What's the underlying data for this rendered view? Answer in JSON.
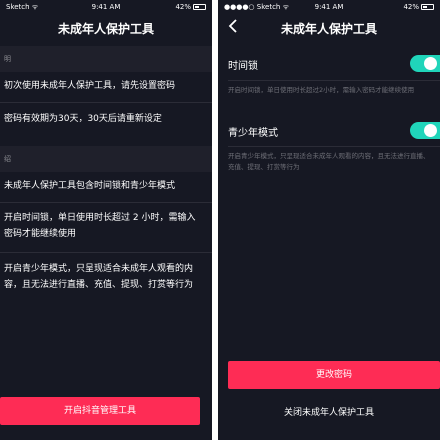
{
  "left": {
    "status": {
      "signal": "Sketch ᯤ",
      "time": "9:41 AM",
      "battery": "42%"
    },
    "title": "未成年人保护工具",
    "section1_head": "明",
    "line1": "初次使用未成年人保护工具，请先设置密码",
    "line2": "密码有效期为30天，30天后请重新设定",
    "section2_head": "绍",
    "line3": "未成年人保护工具包含时间锁和青少年模式",
    "line4": "开启时间锁，单日使用时长超过 2 小时，需输入密码才能继续使用",
    "line5": "开启青少年模式，只呈现适合未成年人观看的内容，且无法进行直播、充值、提现、打赏等行为",
    "button": "开启抖音管理工具"
  },
  "right": {
    "status": {
      "signal": "●●●●○ Sketch ᯤ",
      "time": "9:41 AM",
      "battery": "42%"
    },
    "title": "未成年人保护工具",
    "timelock_label": "时间锁",
    "timelock_on": true,
    "timelock_desc": "开启时间锁，单日使用时长超过2小时，需输入密码才能继续使用",
    "teen_label": "青少年模式",
    "teen_on": true,
    "teen_desc": "开启青少年模式，只呈现适合未成年人观看的内容，且无法进行直播、充值、提现、打赏等行为",
    "change_password": "更改密码",
    "close_tool": "关闭未成年人保护工具"
  },
  "colors": {
    "background": "#161823",
    "accent": "#fe2c55",
    "toggle_on": "#20d5ba"
  }
}
